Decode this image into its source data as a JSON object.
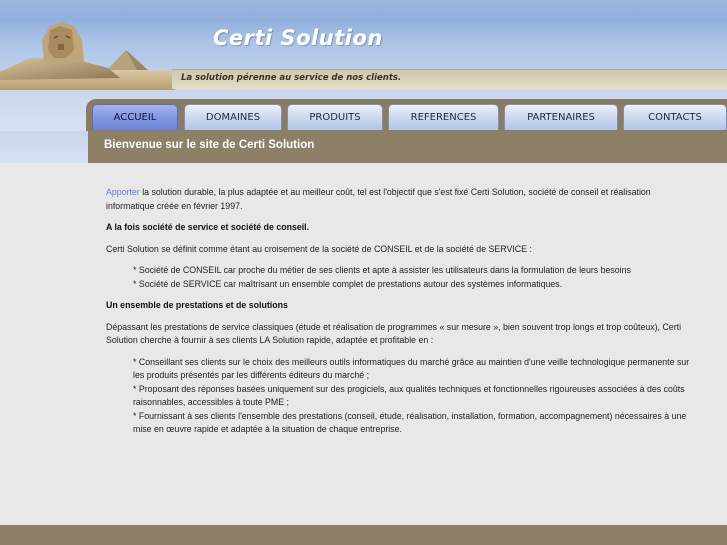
{
  "header": {
    "title": "Certi Solution",
    "tagline": "La solution pérenne au service de nos clients."
  },
  "nav": {
    "tabs": [
      {
        "label": "ACCUEIL",
        "active": true
      },
      {
        "label": "DOMAINES",
        "active": false
      },
      {
        "label": "PRODUITS",
        "active": false
      },
      {
        "label": "REFERENCES",
        "active": false
      },
      {
        "label": "PARTENAIRES",
        "active": false
      },
      {
        "label": "CONTACTS",
        "active": false
      }
    ]
  },
  "page": {
    "heading": "Bienvenue sur le site de Certi Solution"
  },
  "content": {
    "intro_link": "Apporter",
    "intro_text": " la solution durable, la plus adaptée et au meilleur coût, tel est l'objectif que s'est fixé Certi Solution, société de conseil et réalisation informatique créée en février 1997.",
    "heading1": "A la fois société de service et société de conseil.",
    "para1": "Certi Solution se définit comme étant au croisement de la société de CONSEIL et de la société de SERVICE :",
    "bullet1a": "* Société de CONSEIL car proche du métier de ses clients et apte à assister les utilisateurs dans la formulation de leurs besoins",
    "bullet1b": "* Société de SERVICE car maîtrisant un ensemble complet de prestations autour des systèmes informatiques.",
    "heading2": "Un ensemble de prestations et de solutions",
    "para2": "Dépassant les prestations de service classiques (étude et réalisation de programmes « sur mesure », bien souvent trop longs et trop coûteux), Certi Solution cherche à fournir à ses clients LA Solution rapide, adaptée et profitable en :",
    "bullet2a": "* Conseillant ses clients sur le choix des meilleurs outils informatiques du marché grâce au maintien d'une veille technologique permanente sur les produits présentés par les différents éditeurs du marché ;",
    "bullet2b": "* Proposant des réponses basées uniquement sur des progiciels, aux qualités techniques et fonctionnelles rigoureuses associées à des coûts raisonnables, accessibles à toute PME ;",
    "bullet2c": "* Fournissant à ses clients l'ensemble des prestations (conseil, étude, réalisation, installation, formation, accompagnement) nécessaires à une mise en œuvre rapide et adaptée à la situation de chaque entreprise."
  },
  "colors": {
    "nav_band": "#8a7b63",
    "active_tab": "#7d92df",
    "link": "#5b7fd0"
  }
}
